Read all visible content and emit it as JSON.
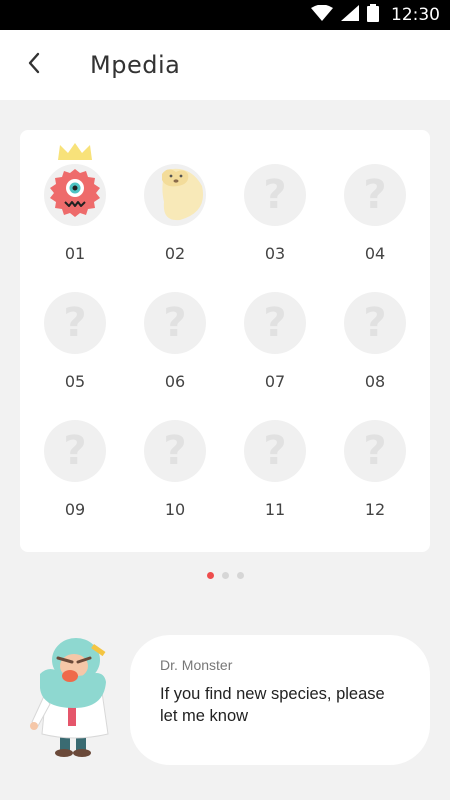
{
  "status_bar": {
    "time": "12:30"
  },
  "app_bar": {
    "title": "Mpedia"
  },
  "grid": {
    "items": [
      {
        "number": "01",
        "state": "discovered",
        "monster": "red-furry-cyclops"
      },
      {
        "number": "02",
        "state": "discovered",
        "monster": "cream-dog"
      },
      {
        "number": "03",
        "state": "unknown",
        "placeholder": "?"
      },
      {
        "number": "04",
        "state": "unknown",
        "placeholder": "?"
      },
      {
        "number": "05",
        "state": "unknown",
        "placeholder": "?"
      },
      {
        "number": "06",
        "state": "unknown",
        "placeholder": "?"
      },
      {
        "number": "07",
        "state": "unknown",
        "placeholder": "?"
      },
      {
        "number": "08",
        "state": "unknown",
        "placeholder": "?"
      },
      {
        "number": "09",
        "state": "unknown",
        "placeholder": "?"
      },
      {
        "number": "10",
        "state": "unknown",
        "placeholder": "?"
      },
      {
        "number": "11",
        "state": "unknown",
        "placeholder": "?"
      },
      {
        "number": "12",
        "state": "unknown",
        "placeholder": "?"
      }
    ]
  },
  "pager": {
    "pages": 3,
    "active": 0
  },
  "dialog": {
    "speaker": "Dr. Monster",
    "message": "If you find new species, please let me know"
  },
  "colors": {
    "background": "#f2f2f2",
    "card": "#ffffff",
    "placeholder_circle": "#f0f0f0",
    "placeholder_mark": "#e1e1e1",
    "active_dot": "#ee4d4d",
    "crown": "#f8e27a"
  }
}
